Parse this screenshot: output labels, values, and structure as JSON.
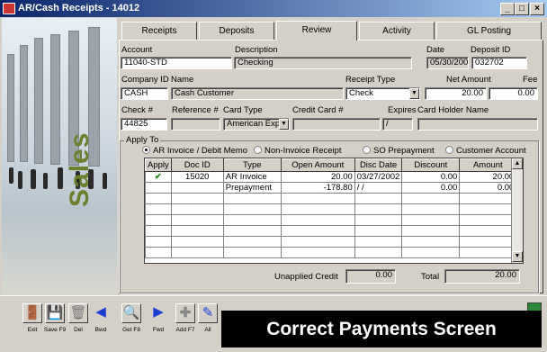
{
  "window": {
    "title": "AR/Cash Receipts - 14012",
    "min": "_",
    "max": "□",
    "close": "×"
  },
  "sidebar": {
    "text": "Sales"
  },
  "tabs": [
    {
      "label": "Receipts",
      "active": false
    },
    {
      "label": "Deposits",
      "active": false
    },
    {
      "label": "Review",
      "active": true
    },
    {
      "label": "Activity",
      "active": false
    },
    {
      "label": "GL Posting",
      "active": false
    }
  ],
  "form": {
    "account_label": "Account",
    "account": "11040-STD",
    "description_label": "Description",
    "description": "Checking",
    "date_label": "Date",
    "date": "05/30/2002",
    "deposit_label": "Deposit ID",
    "deposit": "032702",
    "company_label": "Company ID",
    "company": "CASH",
    "name_label": "Name",
    "name": "Cash Customer",
    "receipt_type_label": "Receipt Type",
    "receipt_type": "Check",
    "net_amount_label": "Net Amount",
    "net_amount": "20.00",
    "fee_label": "Fee",
    "fee": "0.00",
    "check_label": "Check #",
    "check": "44825",
    "reference_label": "Reference #",
    "reference": "",
    "card_type_label": "Card Type",
    "card_type": "American Expr",
    "credit_card_label": "Credit Card #",
    "credit_card": "",
    "expires_label": "Expires",
    "expires": "/",
    "card_holder_label": "Card Holder Name",
    "card_holder": ""
  },
  "apply_to": {
    "label": "Apply To",
    "options": [
      {
        "label": "AR Invoice / Debit Memo",
        "selected": true
      },
      {
        "label": "Non-Invoice Receipt",
        "selected": false
      },
      {
        "label": "SO Prepayment",
        "selected": false
      },
      {
        "label": "Customer Account",
        "selected": false
      }
    ]
  },
  "grid": {
    "columns": [
      "Apply",
      "Doc ID",
      "Type",
      "Open Amount",
      "Disc Date",
      "Discount",
      "Amount"
    ],
    "rows": [
      {
        "apply": "✔",
        "doc_id": "15020",
        "type": "AR Invoice",
        "open_amount": "20.00",
        "disc_date": "03/27/2002",
        "discount": "0.00",
        "amount": "20.00"
      },
      {
        "apply": "",
        "doc_id": "",
        "type": "Prepayment",
        "open_amount": "-178.80",
        "disc_date": "/ /",
        "discount": "0.00",
        "amount": "0.00"
      }
    ]
  },
  "totals": {
    "unapplied_label": "Unapplied Credit",
    "unapplied": "0.00",
    "total_label": "Total",
    "total": "20.00"
  },
  "toolbar": {
    "items": [
      {
        "label": "Exit",
        "icon": "exit-door-icon"
      },
      {
        "label": "Save F9",
        "icon": "floppy-disk-icon"
      },
      {
        "label": "Del",
        "icon": "trash-can-icon"
      },
      {
        "label": "Bwd",
        "icon": "arrow-left-icon"
      },
      {
        "label": "Get F8",
        "icon": "magnifier-icon"
      },
      {
        "label": "Fwd",
        "icon": "arrow-right-icon"
      },
      {
        "label": "Add F7",
        "icon": "plus-icon"
      },
      {
        "label": "All",
        "icon": "apply-all-icon"
      }
    ]
  },
  "banner": {
    "text": "Correct Payments Screen"
  },
  "colors": {
    "titlebar": "#0a246a",
    "check": "#1a8a1a",
    "sales": "#6b7f2f",
    "arrow": "#1c3fd0"
  }
}
